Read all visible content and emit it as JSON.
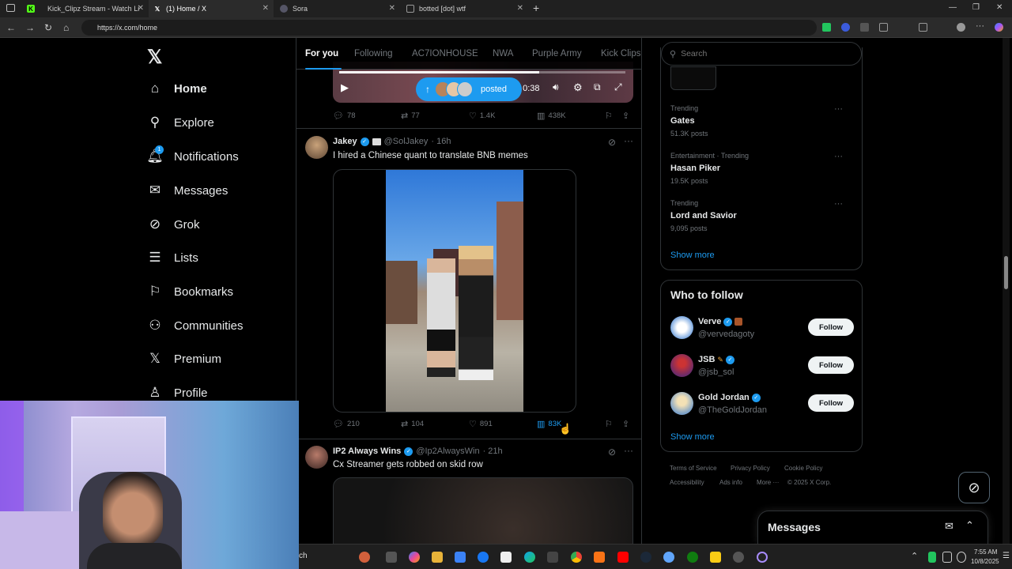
{
  "browser": {
    "tabs": [
      {
        "title": "Kick_Clipz Stream - Watch Li"
      },
      {
        "title": "(1) Home / X"
      },
      {
        "title": "Sora"
      },
      {
        "title": "botted [dot] wtf"
      }
    ],
    "url": "https://x.com/home"
  },
  "sidebar": {
    "logo": "X",
    "items": [
      {
        "label": "Home",
        "icon": "home-icon"
      },
      {
        "label": "Explore",
        "icon": "search-icon"
      },
      {
        "label": "Notifications",
        "icon": "bell-icon",
        "badge": "1"
      },
      {
        "label": "Messages",
        "icon": "mail-icon"
      },
      {
        "label": "Grok",
        "icon": "grok-icon"
      },
      {
        "label": "Lists",
        "icon": "list-icon"
      },
      {
        "label": "Bookmarks",
        "icon": "bookmark-icon"
      },
      {
        "label": "Communities",
        "icon": "people-icon"
      },
      {
        "label": "Premium",
        "icon": "x-icon"
      },
      {
        "label": "Profile",
        "icon": "person-icon"
      }
    ]
  },
  "feed_tabs": [
    "For you",
    "Following",
    "AC7IONHOUSE",
    "NWA",
    "Purple Army",
    "Kick Clips"
  ],
  "video_player": {
    "time": "/ 0:38",
    "posted_label": "posted"
  },
  "post0_stats": {
    "replies": "78",
    "reposts": "77",
    "likes": "1.4K",
    "views": "438K"
  },
  "post1": {
    "name": "Jakey",
    "handle": "@SolJakey",
    "time": "· 16h",
    "text": "I hired a Chinese quant to translate BNB memes",
    "replies": "210",
    "reposts": "104",
    "likes": "891",
    "views": "83K"
  },
  "post2": {
    "name": "IP2 Always Wins",
    "handle": "@Ip2AlwaysWin",
    "time": "· 21h",
    "text": "Cx Streamer gets robbed on skid row"
  },
  "search": {
    "placeholder": "Search"
  },
  "trends": [
    {
      "category": "Trending",
      "name": "Gates",
      "count": "51.3K posts"
    },
    {
      "category": "Entertainment · Trending",
      "name": "Hasan Piker",
      "count": "19.5K posts"
    },
    {
      "category": "Trending",
      "name": "Lord and Savior",
      "count": "9,095 posts"
    }
  ],
  "show_more": "Show more",
  "who_to_follow": {
    "title": "Who to follow",
    "accounts": [
      {
        "name": "Verve",
        "handle": "@vervedagoty"
      },
      {
        "name": "JSB",
        "handle": "@jsb_sol"
      },
      {
        "name": "Gold Jordan",
        "handle": "@TheGoldJordan"
      }
    ],
    "button": "Follow",
    "show_more": "Show more"
  },
  "footer": {
    "links": [
      "Terms of Service",
      "Privacy Policy",
      "Cookie Policy",
      "Accessibility",
      "Ads info",
      "More ···"
    ],
    "copyright": "© 2025 X Corp."
  },
  "messages_drawer": {
    "title": "Messages"
  },
  "taskbar": {
    "search_fragment": "ch",
    "time": "7:55 AM",
    "date": "10/8/2025"
  },
  "colors": {
    "accent": "#1d9bf0",
    "background": "#000000",
    "border": "#2f3336"
  }
}
